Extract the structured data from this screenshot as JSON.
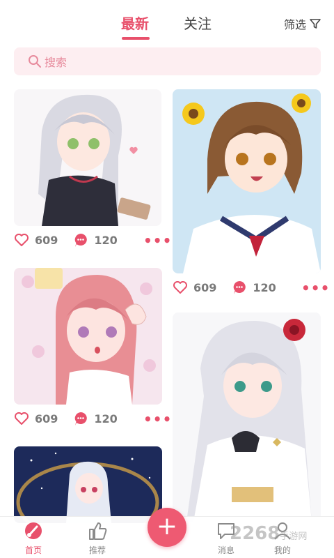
{
  "header": {
    "tabs": [
      {
        "label": "最新"
      },
      {
        "label": "关注"
      }
    ],
    "filter_label": "筛选"
  },
  "search": {
    "placeholder": "搜索"
  },
  "colors": {
    "accent": "#e8506b",
    "search_bg": "#fdeef1"
  },
  "cards": [
    {
      "likes": "609",
      "comments": "120",
      "more": "•••"
    },
    {
      "likes": "609",
      "comments": "120",
      "more": "•••"
    },
    {
      "likes": "609",
      "comments": "120",
      "more": "•••"
    }
  ],
  "bottom_nav": {
    "items": [
      {
        "label": "首页",
        "icon": "brush-icon"
      },
      {
        "label": "推荐",
        "icon": "thumbs-up-icon"
      },
      {
        "label": "消息",
        "icon": "chat-icon"
      },
      {
        "label": "我的",
        "icon": "user-icon"
      }
    ],
    "fab_label": "+"
  },
  "watermark": {
    "brand": "2268",
    "suffix": "手游网"
  }
}
